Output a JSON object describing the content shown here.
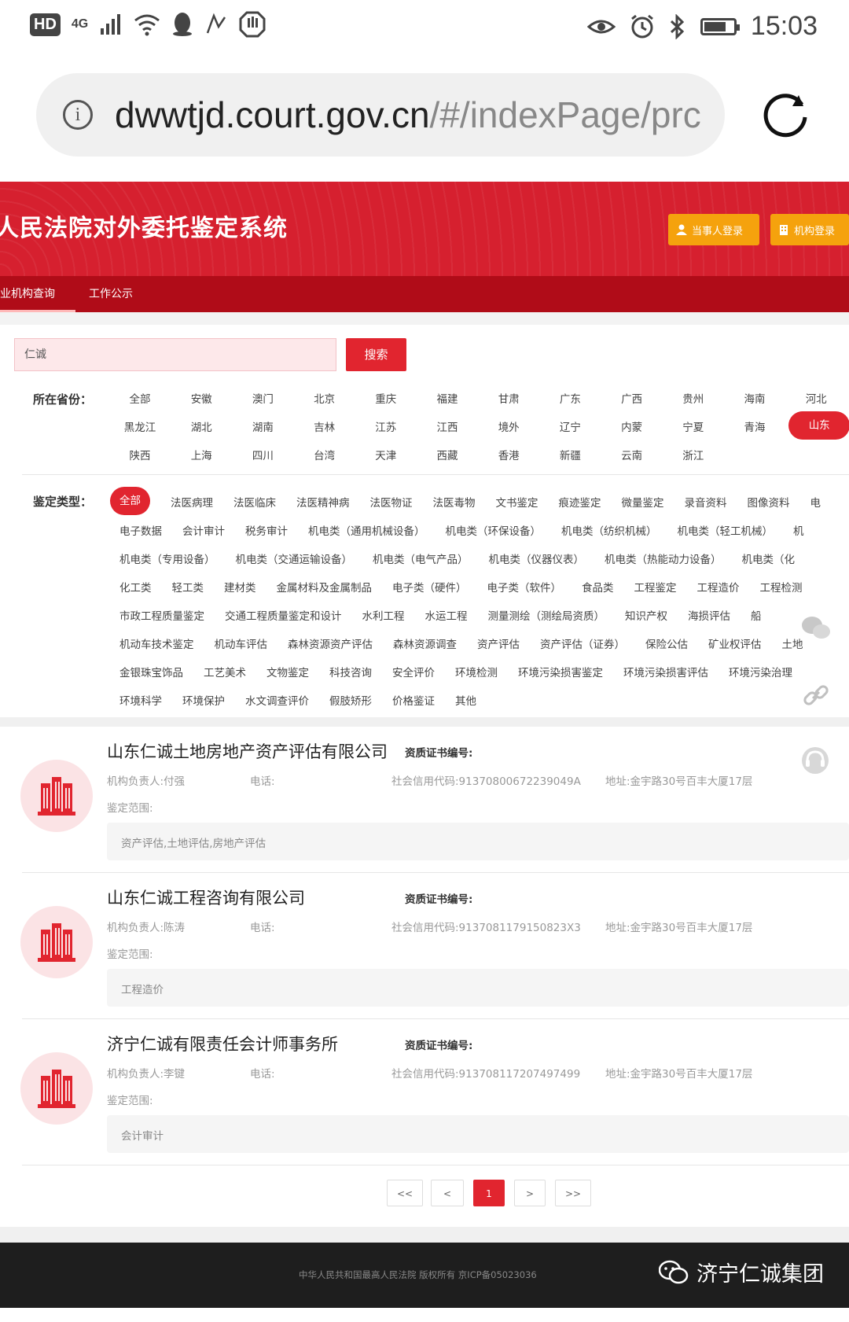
{
  "status_bar": {
    "hd": "HD",
    "network": "4G",
    "time": "15:03",
    "battery_level": 0.75
  },
  "browser": {
    "url_main": "dwwtjd.court.gov.cn",
    "url_dim": "/#/indexPage/prc"
  },
  "header": {
    "title": "人民法院对外委托鉴定系统",
    "login_party": "当事人登录",
    "login_org": "机构登录"
  },
  "nav": {
    "items": [
      "专业机构查询",
      "工作公示"
    ]
  },
  "search": {
    "value": "仁诚",
    "button": "搜索"
  },
  "filters": {
    "province_label": "所在省份：",
    "provinces": [
      [
        "全部",
        "安徽",
        "澳门",
        "北京",
        "重庆",
        "福建",
        "甘肃",
        "广东",
        "广西",
        "贵州",
        "海南",
        "河北"
      ],
      [
        "黑龙江",
        "湖北",
        "湖南",
        "吉林",
        "江苏",
        "江西",
        "境外",
        "辽宁",
        "内蒙",
        "宁夏",
        "青海",
        "山东"
      ],
      [
        "陕西",
        "上海",
        "四川",
        "台湾",
        "天津",
        "西藏",
        "香港",
        "新疆",
        "云南",
        "浙江"
      ]
    ],
    "province_selected": "山东",
    "type_label": "鉴定类型：",
    "types": [
      [
        "全部",
        "法医病理",
        "法医临床",
        "法医精神病",
        "法医物证",
        "法医毒物",
        "文书鉴定",
        "痕迹鉴定",
        "微量鉴定",
        "录音资料",
        "图像资料",
        "电"
      ],
      [
        "电子数据",
        "会计审计",
        "税务审计",
        "机电类（通用机械设备）",
        "机电类（环保设备）",
        "机电类（纺织机械）",
        "机电类（轻工机械）",
        "机"
      ],
      [
        "机电类（专用设备）",
        "机电类（交通运输设备）",
        "机电类（电气产品）",
        "机电类（仪器仪表）",
        "机电类（热能动力设备）",
        "机电类（化"
      ],
      [
        "化工类",
        "轻工类",
        "建材类",
        "金属材料及金属制品",
        "电子类（硬件）",
        "电子类（软件）",
        "食品类",
        "工程鉴定",
        "工程造价",
        "工程检测"
      ],
      [
        "市政工程质量鉴定",
        "交通工程质量鉴定和设计",
        "水利工程",
        "水运工程",
        "测量测绘（测绘局资质）",
        "知识产权",
        "海损评估",
        "船"
      ],
      [
        "机动车技术鉴定",
        "机动车评估",
        "森林资源资产评估",
        "森林资源调查",
        "资产评估",
        "资产评估（证券）",
        "保险公估",
        "矿业权评估",
        "土地"
      ],
      [
        "金银珠宝饰品",
        "工艺美术",
        "文物鉴定",
        "科技咨询",
        "安全评价",
        "环境检测",
        "环境污染损害鉴定",
        "环境污染损害评估",
        "环境污染治理"
      ],
      [
        "环境科学",
        "环境保护",
        "水文调查评价",
        "假肢矫形",
        "价格鉴证",
        "其他"
      ]
    ],
    "type_selected": "全部"
  },
  "results": [
    {
      "name": "山东仁诚土地房地产资产评估有限公司",
      "cert_label": "资质证书编号:",
      "leader": "机构负责人:付强",
      "phone": "电话:",
      "credit": "社会信用代码:91370800672239049A",
      "address": "地址:金宇路30号百丰大厦17层",
      "scope_label": "鉴定范围:",
      "scope": "资产评估,土地评估,房地产评估"
    },
    {
      "name": "山东仁诚工程咨询有限公司",
      "cert_label": "资质证书编号:",
      "leader": "机构负责人:陈涛",
      "phone": "电话:",
      "credit": "社会信用代码:9137081179150823X3",
      "address": "地址:金宇路30号百丰大厦17层",
      "scope_label": "鉴定范围:",
      "scope": "工程造价"
    },
    {
      "name": "济宁仁诚有限责任会计师事务所",
      "cert_label": "资质证书编号:",
      "leader": "机构负责人:李键",
      "phone": "电话:",
      "credit": "社会信用代码:91370811720749749​9",
      "address": "地址:金宇路30号百丰大厦17层",
      "scope_label": "鉴定范围:",
      "scope": "会计审计"
    }
  ],
  "pagination": {
    "first": "<<",
    "prev": "<",
    "current": "1",
    "next": ">",
    "last": ">>"
  },
  "footer": {
    "text": "中华人民共和国最高人民法院 版权所有 京ICP备05023036",
    "watermark": "济宁仁诚集团"
  },
  "colors": {
    "brand_red": "#d6202f",
    "nav_red": "#b00c18",
    "accent_orange": "#f5a20d"
  }
}
